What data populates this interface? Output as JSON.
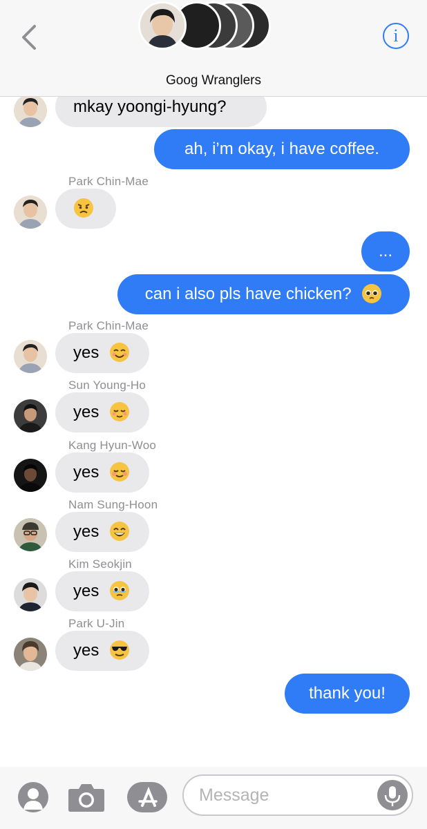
{
  "header": {
    "group_name": "Goog Wranglers",
    "back_icon": "chevron-left-icon",
    "info_label": "i"
  },
  "messages": [
    {
      "direction": "in",
      "text": "mkay yoongi-hyung?"
    },
    {
      "direction": "out",
      "text": "ah, i’m okay, i have coffee."
    },
    {
      "direction": "in",
      "sender": "Park Chin-Mae",
      "text": "",
      "emoji": "angry-face"
    },
    {
      "direction": "out",
      "text": "..."
    },
    {
      "direction": "out",
      "text": "can i also pls have chicken?",
      "emoji": "pleading-face"
    },
    {
      "direction": "in",
      "sender": "Park Chin-Mae",
      "text": "yes",
      "emoji": "smiling-face-with-smiling-eyes"
    },
    {
      "direction": "in",
      "sender": "Sun Young-Ho",
      "text": "yes",
      "emoji": "relieved-face"
    },
    {
      "direction": "in",
      "sender": "Kang Hyun-Woo",
      "text": "yes",
      "emoji": "smiling-face"
    },
    {
      "direction": "in",
      "sender": "Nam Sung-Hoon",
      "text": "yes",
      "emoji": "grinning-face-with-smiling-eyes"
    },
    {
      "direction": "in",
      "sender": "Kim Seokjin",
      "text": "yes",
      "emoji": "face-holding-back-tears"
    },
    {
      "direction": "in",
      "sender": "Park U-Jin",
      "text": "yes",
      "emoji": "smiling-face-with-sunglasses"
    },
    {
      "direction": "out",
      "text": "thank you!"
    }
  ],
  "composer": {
    "placeholder": "Message"
  },
  "colors": {
    "outgoing_bubble": "#2f7cf6",
    "incoming_bubble": "#e9e9eb",
    "sender_name": "#8e8e93",
    "accent": "#2f7cf6"
  }
}
